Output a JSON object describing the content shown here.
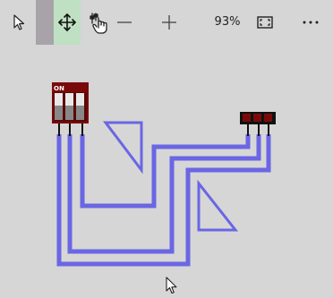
{
  "toolbar": {
    "select_tool": {
      "icon": "arrow-pointer-icon",
      "active": false
    },
    "move_tool": {
      "icon": "move-arrows-icon",
      "active": true,
      "highlight_color": "#bfe0c3"
    },
    "interact_tool": {
      "icon": "hand-switch-icon",
      "active": false
    },
    "zoom_out": {
      "icon": "minus-icon"
    },
    "zoom_in": {
      "icon": "plus-icon"
    },
    "zoom_level": "93%",
    "fit_to_screen": {
      "icon": "fit-screen-icon"
    },
    "more_menu": {
      "icon": "ellipsis-icon"
    },
    "left_marker_color": "#a7a3a8"
  },
  "canvas": {
    "background": "#d6d6d6",
    "wire_color": "#6a66e4",
    "dip_switch": {
      "label": "ON",
      "body_color": "#7a0a0a",
      "positions": 3
    },
    "header_connector": {
      "pins": 3,
      "body_color": "#111111",
      "pin_color": "#7a0a0a"
    }
  }
}
